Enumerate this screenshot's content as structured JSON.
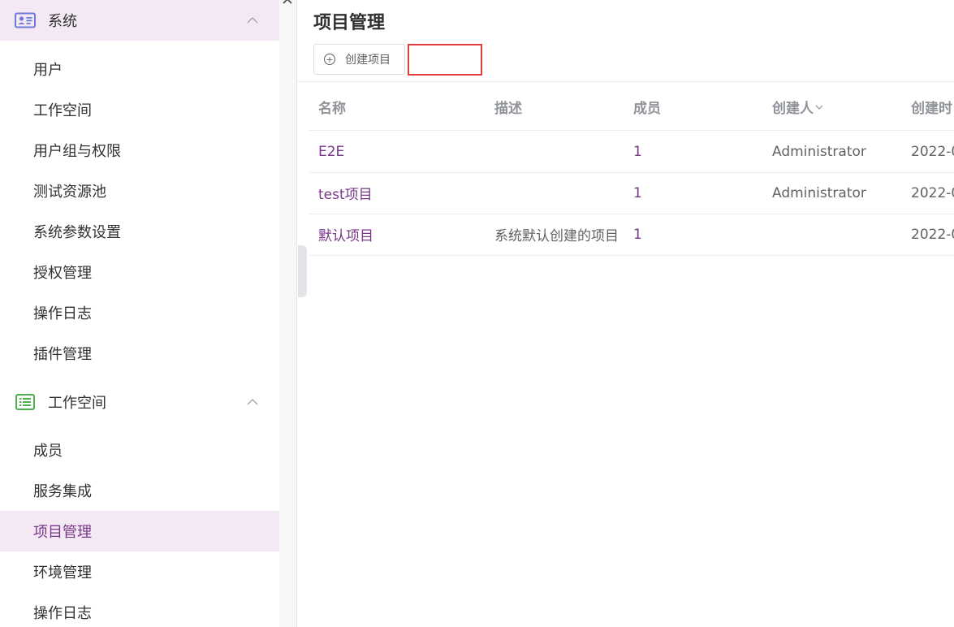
{
  "sidebar": {
    "groups": [
      {
        "label": "系统",
        "icon": "id-card-icon",
        "items": [
          "用户",
          "工作空间",
          "用户组与权限",
          "测试资源池",
          "系统参数设置",
          "授权管理",
          "操作日志",
          "插件管理"
        ]
      },
      {
        "label": "工作空间",
        "icon": "list-icon",
        "items": [
          "成员",
          "服务集成",
          "项目管理",
          "环境管理",
          "操作日志"
        ]
      }
    ],
    "active_item": "项目管理",
    "chevron": "^"
  },
  "main": {
    "title": "项目管理",
    "create_button_label": "创建项目",
    "search_value": ""
  },
  "table": {
    "headers": {
      "name": "名称",
      "description": "描述",
      "members": "成员",
      "creator": "创建人",
      "created_time": "创建时"
    },
    "rows": [
      {
        "name": "E2E",
        "description": "",
        "members": "1",
        "creator": "Administrator",
        "created_time": "2022-0"
      },
      {
        "name": "test项目",
        "description": "",
        "members": "1",
        "creator": "Administrator",
        "created_time": "2022-0"
      },
      {
        "name": "默认项目",
        "description": "系统默认创建的项目",
        "members": "1",
        "creator": "",
        "created_time": "2022-0"
      }
    ]
  },
  "colors": {
    "accent": "#783887",
    "active_bg": "#f3e8f4",
    "highlight_border": "#e03d3d",
    "system_icon": "#6c7bd8",
    "workspace_icon": "#4caf50"
  }
}
